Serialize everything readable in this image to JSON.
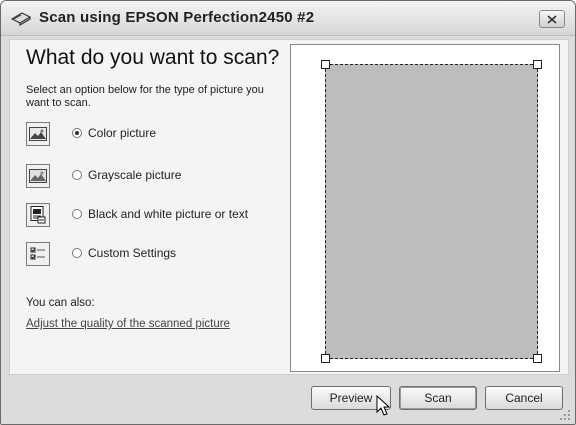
{
  "window": {
    "title": "Scan using EPSON Perfection2450 #2"
  },
  "main": {
    "heading": "What do you want to scan?",
    "instruction": "Select an option below for the type of picture you want to scan.",
    "options": [
      {
        "label": "Color picture",
        "selected": true,
        "icon": "color-photo-icon"
      },
      {
        "label": "Grayscale picture",
        "selected": false,
        "icon": "grayscale-photo-icon"
      },
      {
        "label": "Black and white picture or text",
        "selected": false,
        "icon": "bw-document-icon"
      },
      {
        "label": "Custom Settings",
        "selected": false,
        "icon": "custom-settings-icon"
      }
    ],
    "also_label": "You can also:",
    "adjust_link": "Adjust the quality of the scanned picture"
  },
  "buttons": {
    "preview": "Preview",
    "scan": "Scan",
    "cancel": "Cancel"
  }
}
